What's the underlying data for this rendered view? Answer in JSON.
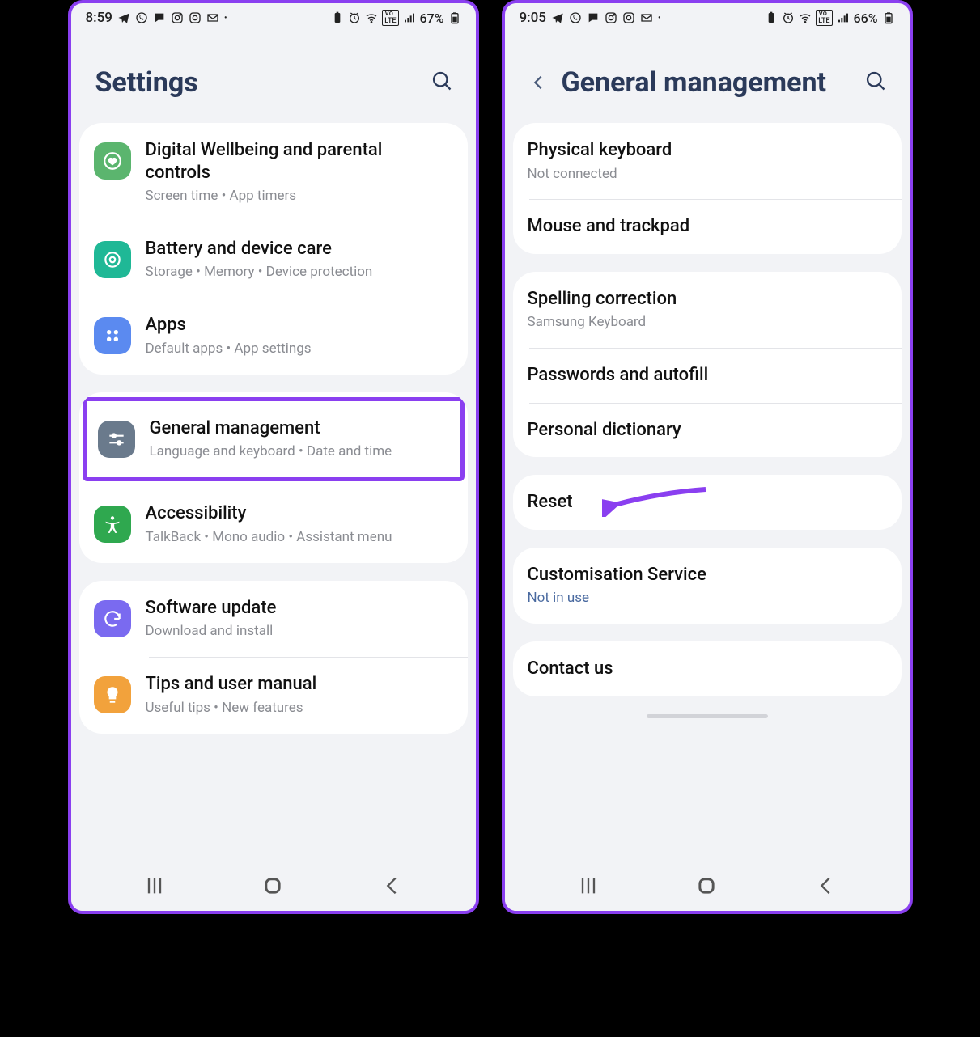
{
  "left": {
    "status": {
      "time": "8:59",
      "battery": "67%"
    },
    "title": "Settings",
    "groups": [
      {
        "rows": [
          {
            "icon": "heart",
            "bg": "bg-green1",
            "title": "Digital Wellbeing and parental controls",
            "sub": "Screen time  •  App timers"
          },
          {
            "icon": "care",
            "bg": "bg-teal",
            "title": "Battery and device care",
            "sub": "Storage  •  Memory  •  Device protection"
          },
          {
            "icon": "apps",
            "bg": "bg-blue1",
            "title": "Apps",
            "sub": "Default apps  •  App settings"
          }
        ]
      },
      {
        "highlight": 0,
        "rows": [
          {
            "icon": "sliders",
            "bg": "bg-slate",
            "title": "General management",
            "sub": "Language and keyboard  •  Date and time"
          },
          {
            "icon": "access",
            "bg": "bg-green2",
            "title": "Accessibility",
            "sub": "TalkBack  •  Mono audio  •  Assistant menu"
          }
        ]
      },
      {
        "rows": [
          {
            "icon": "update",
            "bg": "bg-purple",
            "title": "Software update",
            "sub": "Download and install"
          },
          {
            "icon": "tips",
            "bg": "bg-orange",
            "title": "Tips and user manual",
            "sub": "Useful tips  •  New features"
          }
        ]
      }
    ]
  },
  "right": {
    "status": {
      "time": "9:05",
      "battery": "66%"
    },
    "title": "General management",
    "groups": [
      {
        "rows": [
          {
            "title": "Physical keyboard",
            "sub": "Not connected"
          },
          {
            "title": "Mouse and trackpad"
          }
        ]
      },
      {
        "rows": [
          {
            "title": "Spelling correction",
            "sub": "Samsung Keyboard"
          },
          {
            "title": "Passwords and autofill"
          },
          {
            "title": "Personal dictionary"
          }
        ]
      },
      {
        "arrowOn": 0,
        "rows": [
          {
            "title": "Reset"
          }
        ]
      },
      {
        "rows": [
          {
            "title": "Customisation Service",
            "sub": "Not in use",
            "subLink": true
          }
        ]
      },
      {
        "rows": [
          {
            "title": "Contact us"
          }
        ]
      }
    ]
  }
}
